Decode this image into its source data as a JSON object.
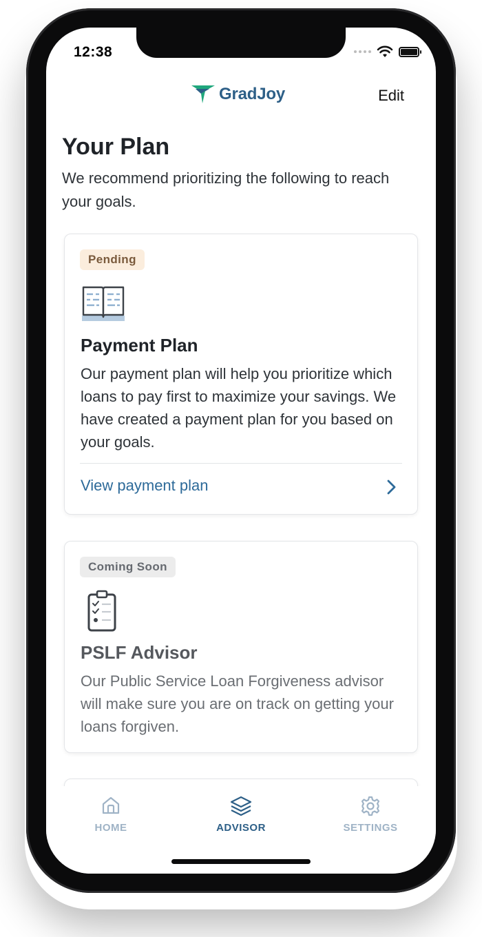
{
  "status": {
    "time": "12:38"
  },
  "header": {
    "logo_text": "GradJoy",
    "edit_label": "Edit"
  },
  "page": {
    "title": "Your Plan",
    "subtitle": "We recommend prioritizing the following to reach your goals."
  },
  "cards": [
    {
      "badge": "Pending",
      "icon": "open-book-icon",
      "title": "Payment Plan",
      "body": "Our payment plan will help you prioritize which loans to pay first to maximize your savings. We have created a payment plan for you based on your goals.",
      "link": "View payment plan"
    },
    {
      "badge": "Coming Soon",
      "icon": "clipboard-checklist-icon",
      "title": "PSLF Advisor",
      "body": "Our Public Service Loan Forgiveness advisor will make sure you are on track on getting your loans forgiven."
    }
  ],
  "tabbar": {
    "tabs": [
      {
        "label": "HOME",
        "icon": "home-icon"
      },
      {
        "label": "ADVISOR",
        "icon": "layers-icon",
        "active": true
      },
      {
        "label": "SETTINGS",
        "icon": "gear-icon"
      }
    ]
  },
  "colors": {
    "brand": "#2d5f87",
    "logo_accent": "#1fa77c",
    "link": "#2d6a99",
    "pending_bg": "#fbeddd",
    "soon_bg": "#ececec",
    "inactive_tab": "#9fb3c6"
  }
}
